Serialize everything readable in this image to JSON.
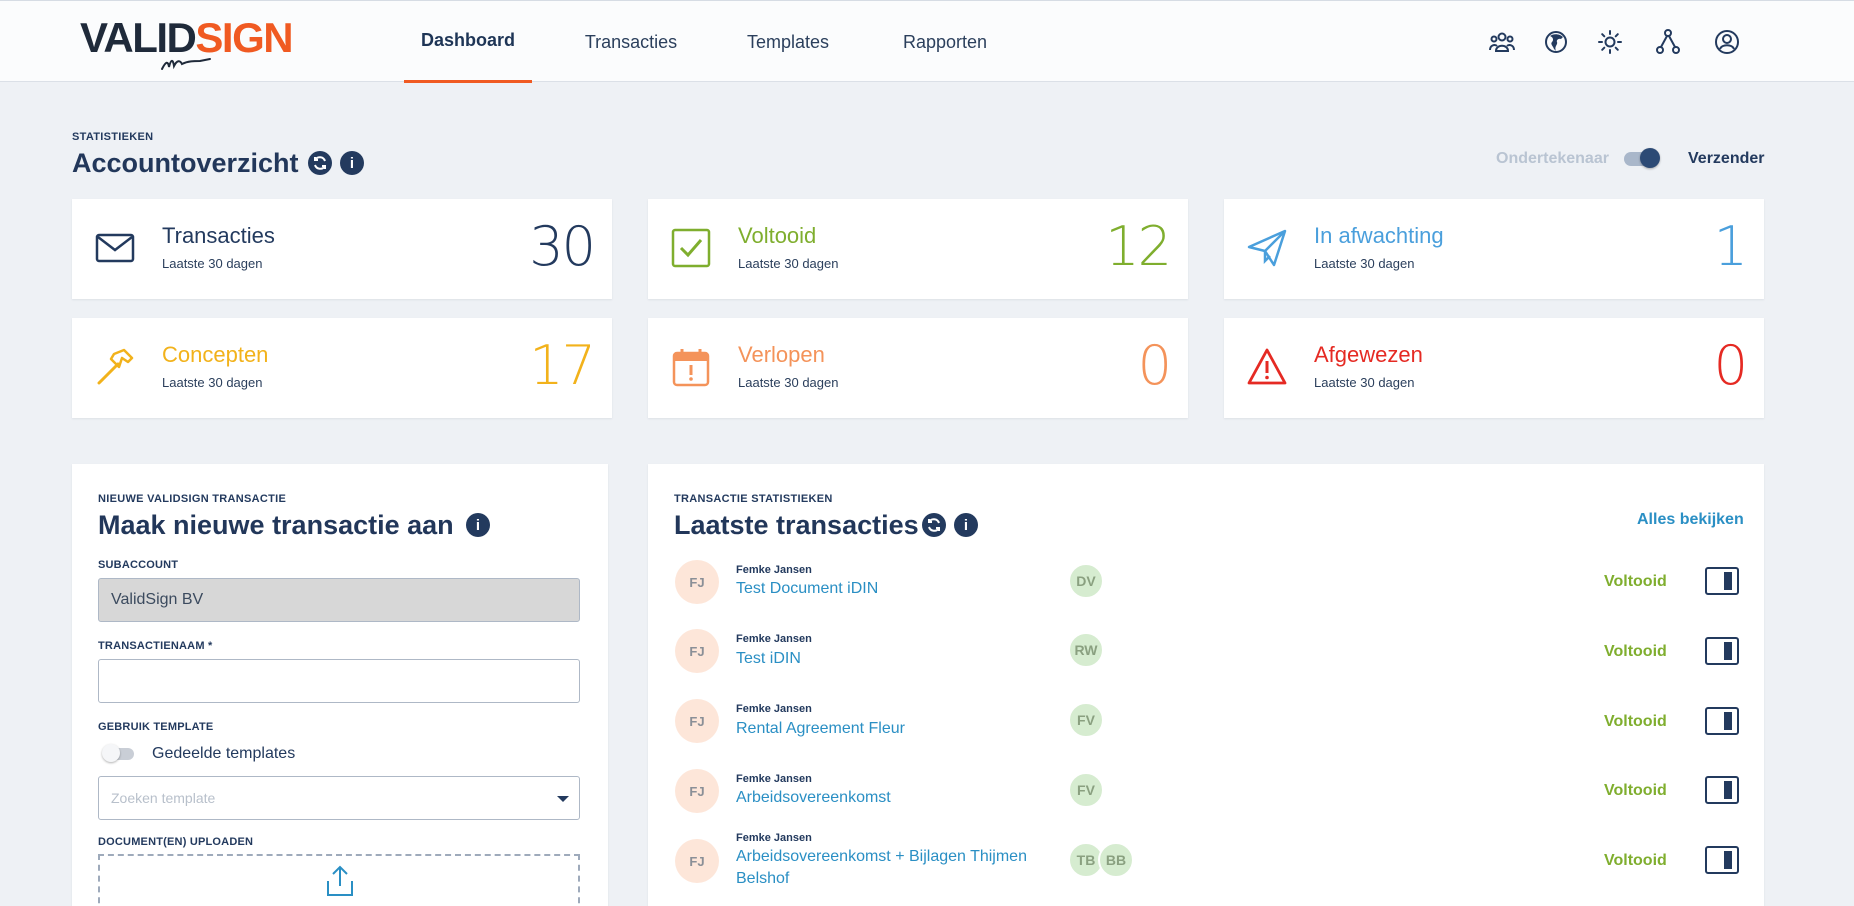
{
  "brand": {
    "logo_valid": "VALID",
    "logo_sign": "SIGN",
    "accent": "#f05a22",
    "navy": "#233a5e"
  },
  "nav": {
    "dashboard": "Dashboard",
    "transacties": "Transacties",
    "templates": "Templates",
    "rapporten": "Rapporten"
  },
  "header_icons": [
    "users-icon",
    "globe-icon",
    "brightness-icon",
    "hierarchy-icon",
    "account-icon"
  ],
  "overview": {
    "eyebrow": "STATISTIEKEN",
    "title": "Accountoverzicht",
    "toggle_left": "Ondertekenaar",
    "toggle_right": "Verzender",
    "toggle_on_right": true
  },
  "stats": [
    {
      "title": "Transacties",
      "subtitle": "Laatste 30 dagen",
      "value": "30",
      "color": "#233a5e",
      "icon": "envelope-icon"
    },
    {
      "title": "Voltooid",
      "subtitle": "Laatste 30 dagen",
      "value": "12",
      "color": "#7fae2e",
      "icon": "checkbox-icon"
    },
    {
      "title": "In afwachting",
      "subtitle": "Laatste 30 dagen",
      "value": "1",
      "color": "#4a9fdc",
      "icon": "paper-plane-icon"
    },
    {
      "title": "Concepten",
      "subtitle": "Laatste 30 dagen",
      "value": "17",
      "color": "#f2b21b",
      "icon": "hammer-icon"
    },
    {
      "title": "Verlopen",
      "subtitle": "Laatste 30 dagen",
      "value": "0",
      "color": "#f4935a",
      "icon": "calendar-alert-icon"
    },
    {
      "title": "Afgewezen",
      "subtitle": "Laatste 30 dagen",
      "value": "0",
      "color": "#e52a23",
      "icon": "warning-icon"
    }
  ],
  "new_tx": {
    "eyebrow": "NIEUWE VALIDSIGN TRANSACTIE",
    "title": "Maak nieuwe transactie aan",
    "subaccount_label": "SUBACCOUNT",
    "subaccount_value": "ValidSign BV",
    "name_label": "TRANSACTIENAAM *",
    "name_value": "",
    "template_label": "GEBRUIK TEMPLATE",
    "shared_templates": "Gedeelde templates",
    "template_placeholder": "Zoeken template",
    "upload_label": "DOCUMENT(EN) UPLOADEN"
  },
  "latest": {
    "eyebrow": "TRANSACTIE STATISTIEKEN",
    "title": "Laatste transacties",
    "view_all": "Alles bekijken",
    "rows": [
      {
        "initials": "FJ",
        "sender": "Femke Jansen",
        "name_line1": "Test Document iDIN",
        "name_line2": "",
        "signers": [
          "DV"
        ],
        "status": "Voltooid"
      },
      {
        "initials": "FJ",
        "sender": "Femke Jansen",
        "name_line1": "Test iDIN",
        "name_line2": "",
        "signers": [
          "RW"
        ],
        "status": "Voltooid"
      },
      {
        "initials": "FJ",
        "sender": "Femke Jansen",
        "name_line1": "Rental Agreement Fleur",
        "name_line2": "",
        "signers": [
          "FV"
        ],
        "status": "Voltooid"
      },
      {
        "initials": "FJ",
        "sender": "Femke Jansen",
        "name_line1": "Arbeidsovereenkomst",
        "name_line2": "",
        "signers": [
          "FV"
        ],
        "status": "Voltooid"
      },
      {
        "initials": "FJ",
        "sender": "Femke Jansen",
        "name_line1": "Arbeidsovereenkomst + Bijlagen Thijmen",
        "name_line2": "Belshof",
        "signers": [
          "TB",
          "BB"
        ],
        "status": "Voltooid"
      }
    ]
  }
}
